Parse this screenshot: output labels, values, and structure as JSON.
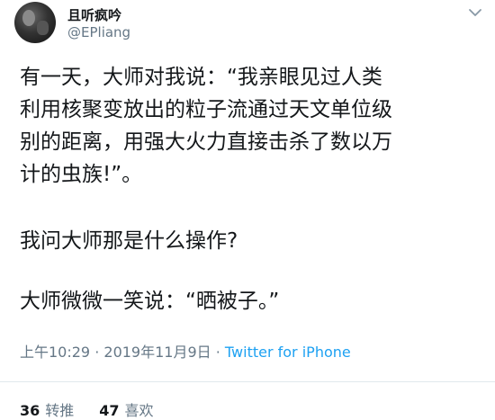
{
  "header": {
    "display_name": "且听疯吟",
    "handle": "@EPliang",
    "menu_icon": "chevron-down-icon"
  },
  "tweet": {
    "line1": "有一天，大师对我说：“我亲眼见过人类",
    "line2": "利用核聚变放出的粒子流通过天文单位级",
    "line3": "别的距离，用强大火力直接击杀了数以万",
    "line4": "计的虫族!”。",
    "para2": "我问大师那是什么操作?",
    "para3": "大师微微一笑说：“晒被子。”"
  },
  "meta": {
    "time": "上午10:29",
    "sep1": " · ",
    "date": "2019年11月9日",
    "sep2": " · ",
    "source": "Twitter for iPhone"
  },
  "stats": {
    "retweets_count": "36",
    "retweets_label": "转推",
    "likes_count": "47",
    "likes_label": "喜欢"
  },
  "colors": {
    "text": "#14171a",
    "muted": "#657786",
    "link": "#1da1f2"
  }
}
